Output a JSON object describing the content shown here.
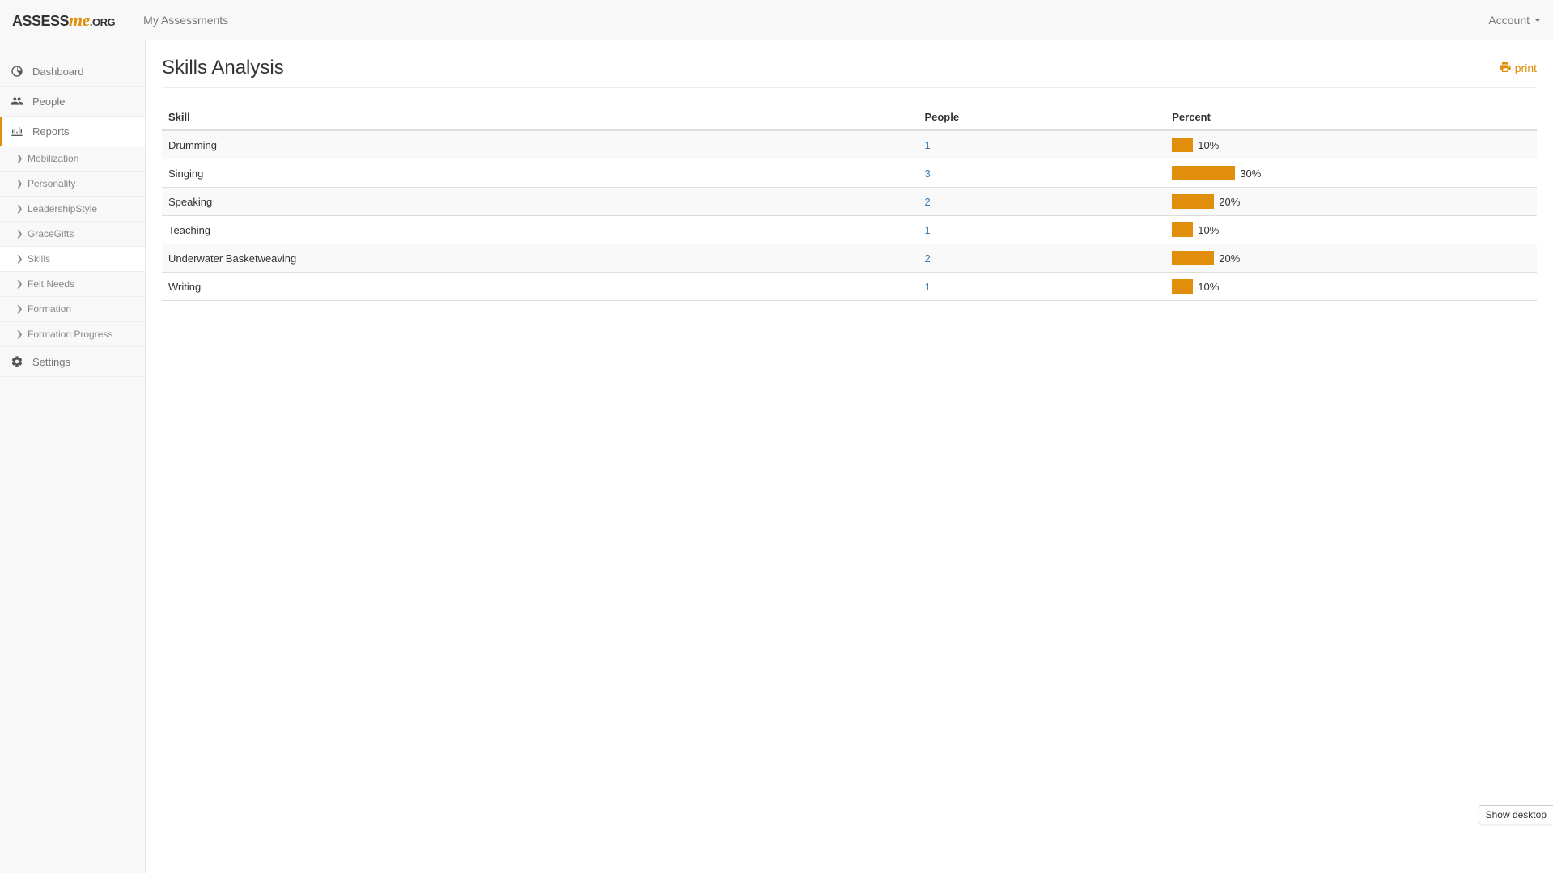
{
  "navbar": {
    "brand_assess": "Assess",
    "brand_me": "me",
    "brand_org": ".org",
    "my_assessments": "My Assessments",
    "account": "Account"
  },
  "sidebar": {
    "dashboard": "Dashboard",
    "people": "People",
    "reports": "Reports",
    "settings": "Settings",
    "subs": {
      "mobilization": "Mobilization",
      "personality": "Personality",
      "leadership": "LeadershipStyle",
      "gracegifts": "GraceGifts",
      "skills": "Skills",
      "feltneeds": "Felt Needs",
      "formation": "Formation",
      "formation_progress": "Formation Progress"
    }
  },
  "page": {
    "title": "Skills Analysis",
    "print": "print"
  },
  "table": {
    "headers": {
      "skill": "Skill",
      "people": "People",
      "percent": "Percent"
    },
    "rows": [
      {
        "skill": "Drumming",
        "people": "1",
        "percent": 10,
        "percent_label": "10%"
      },
      {
        "skill": "Singing",
        "people": "3",
        "percent": 30,
        "percent_label": "30%"
      },
      {
        "skill": "Speaking",
        "people": "2",
        "percent": 20,
        "percent_label": "20%"
      },
      {
        "skill": "Teaching",
        "people": "1",
        "percent": 10,
        "percent_label": "10%"
      },
      {
        "skill": "Underwater Basketweaving",
        "people": "2",
        "percent": 20,
        "percent_label": "20%"
      },
      {
        "skill": "Writing",
        "people": "1",
        "percent": 10,
        "percent_label": "10%"
      }
    ]
  },
  "chart_data": {
    "type": "bar",
    "title": "Skills Analysis",
    "xlabel": "Skill",
    "ylabel": "Percent",
    "ylim": [
      0,
      100
    ],
    "categories": [
      "Drumming",
      "Singing",
      "Speaking",
      "Teaching",
      "Underwater Basketweaving",
      "Writing"
    ],
    "values": [
      10,
      30,
      20,
      10,
      20,
      10
    ]
  },
  "footer": {
    "show_desktop": "Show desktop"
  },
  "colors": {
    "accent": "#e08e0b",
    "link": "#337ab7"
  }
}
